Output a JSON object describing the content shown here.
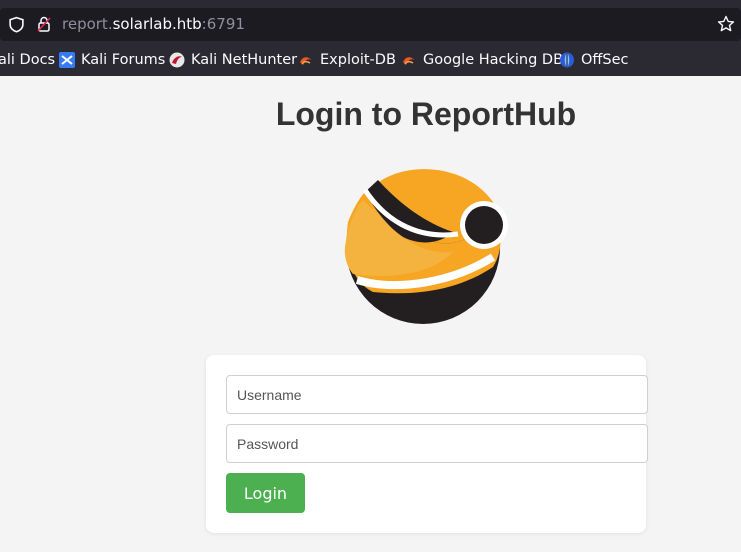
{
  "browser": {
    "url_prefix": "report.",
    "url_host": "solarlab.htb",
    "url_port": ":6791",
    "bookmarks": [
      {
        "label": "ali Docs",
        "icon": "kali-docs-icon"
      },
      {
        "label": "Kali Forums",
        "icon": "kali-forums-icon"
      },
      {
        "label": "Kali NetHunter",
        "icon": "kali-nethunter-icon"
      },
      {
        "label": "Exploit-DB",
        "icon": "exploit-db-icon"
      },
      {
        "label": "Google Hacking DB",
        "icon": "ghdb-icon"
      },
      {
        "label": "OffSec",
        "icon": "offsec-icon"
      }
    ]
  },
  "page": {
    "title": "Login to ReportHub",
    "logo_icon": "reporthub-logo",
    "form": {
      "username_placeholder": "Username",
      "username_value": "",
      "password_placeholder": "Password",
      "password_value": "",
      "login_label": "Login"
    }
  },
  "colors": {
    "login_button": "#4caf50",
    "logo_orange": "#f6a623",
    "logo_dark": "#231f20",
    "page_background": "#f4f4f4"
  }
}
